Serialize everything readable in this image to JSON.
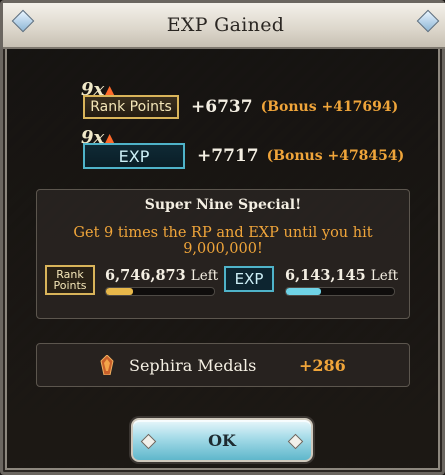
{
  "dialog": {
    "title": "EXP Gained"
  },
  "rank_points": {
    "multiplier": "9x",
    "label": "Rank Points",
    "gain": "+6737",
    "bonus": "(Bonus +417694)"
  },
  "exp": {
    "multiplier": "9x",
    "label": "EXP",
    "gain": "+7717",
    "bonus": "(Bonus +478454)"
  },
  "special": {
    "title": "Super Nine Special!",
    "description": "Get 9 times the RP and EXP until you hit 9,000,000!",
    "rp_badge_line1": "Rank",
    "rp_badge_line2": "Points",
    "rp_left_value": "6,746,873",
    "rp_left_label": "Left",
    "rp_progress": 0.25,
    "exp_badge": "EXP",
    "exp_left_value": "6,143,145",
    "exp_left_label": "Left",
    "exp_progress": 0.32,
    "colors": {
      "rp_fill": "#e8b84a",
      "exp_fill": "#6fd3e6"
    }
  },
  "medals": {
    "label": "Sephira Medals",
    "value": "+286",
    "icon": "sephira-medal-icon"
  },
  "buttons": {
    "ok_label": "OK"
  }
}
